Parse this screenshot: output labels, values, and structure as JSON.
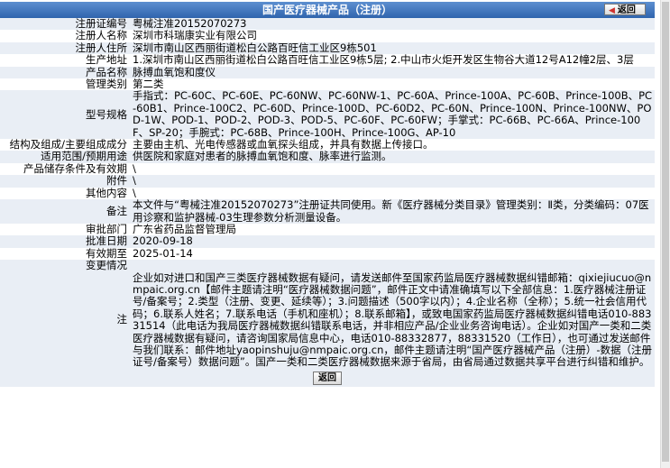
{
  "header": {
    "title": "国产医疗器械产品（注册）",
    "back_label": "返回"
  },
  "rows": [
    {
      "label": "注册证编号",
      "value": "粤械注准20152070273"
    },
    {
      "label": "注册人名称",
      "value": "深圳市科瑞康实业有限公司"
    },
    {
      "label": "注册人住所",
      "value": "深圳市南山区西丽街道松白公路百旺信工业区9栋501"
    },
    {
      "label": "生产地址",
      "value": "1.深圳市南山区西丽街道松白公路百旺信工业区9栋5层; 2.中山市火炬开发区生物谷大道12号A12幢2层、3层"
    },
    {
      "label": "产品名称",
      "value": "脉搏血氧饱和度仪"
    },
    {
      "label": "管理类别",
      "value": "第二类"
    },
    {
      "label": "型号规格",
      "value": "手指式：PC-60C、PC-60E、PC-60NW、PC-60NW-1、PC-60A、Prince-100A、PC-60B、Prince-100B、PC-60B1、Prince-100C2、PC-60D、Prince-100D、PC-60D2、PC-60N、Prince-100N、Prince-100NW、POD-1W、POD-1、POD-2、POD-3、POD-5、PC-60F、PC-60FW；手掌式：PC-66B、PC-66A、Prince-100F、SP-20；手腕式：PC-68B、Prince-100H、Prince-100G、AP-10"
    },
    {
      "label": "结构及组成/主要组成成分",
      "value": "主要由主机、光电传感器或血氧探头组成，并具有数据上传接口。"
    },
    {
      "label": "适用范围/预期用途",
      "value": "供医院和家庭对患者的脉搏血氧饱和度、脉率进行监测。"
    },
    {
      "label": "产品储存条件及有效期",
      "value": "\\"
    },
    {
      "label": "附件",
      "value": "\\"
    },
    {
      "label": "其他内容",
      "value": "\\"
    },
    {
      "label": "备注",
      "value": "本文件与“粤械注准20152070273”注册证共同使用。新《医疗器械分类目录》管理类别：Ⅱ类，分类编码：07医用诊察和监护器械-03生理参数分析测量设备。"
    },
    {
      "label": "审批部门",
      "value": "广东省药品监督管理局"
    },
    {
      "label": "批准日期",
      "value": "2020-09-18"
    },
    {
      "label": "有效期至",
      "value": "2025-01-14"
    },
    {
      "label": "变更情况",
      "value": ""
    }
  ],
  "notice": {
    "label": "注",
    "text": "企业如对进口和国产三类医疗器械数据有疑问，请发送邮件至国家药监局医疗器械数据纠错邮箱：qixiejiucuo@nmpaic.org.cn【邮件主题请注明“医疗器械数据问题”，邮件正文中请准确填写以下全部信息：1.医疗器械注册证号/备案号；2.类型（注册、变更、延续等）；3.问题描述（500字以内）；4.企业名称（全称）；5.统一社会信用代码；6.联系人姓名；7.联系电话（手机和座机）；8.联系邮箱】，或致电国家药监局医疗器械数据纠错电话010-88331514（此电话为我局医疗器械数据纠错联系电话，并非相应产品/企业业务咨询电话）。企业如对国产一类和二类医疗器械数据有疑问，请咨询国家局信息中心，电话010-88332877，88331520（工作日），也可通过发送邮件与我们联系：邮件地址yaopinshuju@nmpaic.org.cn，邮件主题请注明“国产医疗器械产品（注册）-数据（注册证号/备案号）数据问题”。国产一类和二类医疗器械数据来源于省局，由省局通过数据共享平台进行纠错和维护。"
  },
  "footer": {
    "back_label": "返回"
  }
}
